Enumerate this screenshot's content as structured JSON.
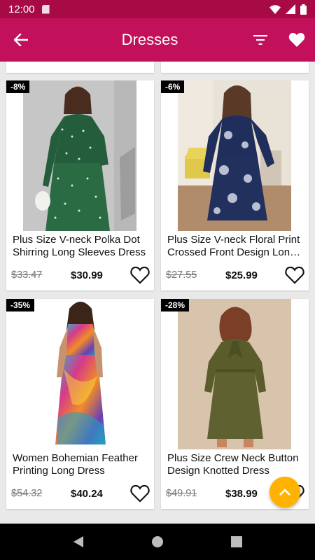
{
  "status_bar": {
    "time": "12:00",
    "icons": [
      "sd-card-icon",
      "wifi-icon",
      "signal-icon",
      "battery-icon"
    ]
  },
  "app_bar": {
    "title": "Dresses",
    "icons": [
      "back-arrow-icon",
      "filter-icon",
      "heart-icon"
    ]
  },
  "products": [
    {
      "discount": "-8%",
      "name": "Plus Size V-neck Polka Dot Shirring Long Sleeves Dress",
      "old_price": "$33.47",
      "price": "$30.99"
    },
    {
      "discount": "-6%",
      "name": "Plus Size V-neck Floral Print Crossed Front Design Long Sleeves Dress",
      "old_price": "$27.55",
      "price": "$25.99"
    },
    {
      "discount": "-35%",
      "name": "Women Bohemian Feather Printing Long Dress",
      "old_price": "$54.32",
      "price": "$40.24"
    },
    {
      "discount": "-28%",
      "name": "Plus Size Crew Neck Button Design Knotted Dress",
      "old_price": "$49.91",
      "price": "$38.99"
    }
  ],
  "colors": {
    "status_bar": "#a80a45",
    "app_bar": "#c2105a",
    "fab": "#ffb300"
  }
}
